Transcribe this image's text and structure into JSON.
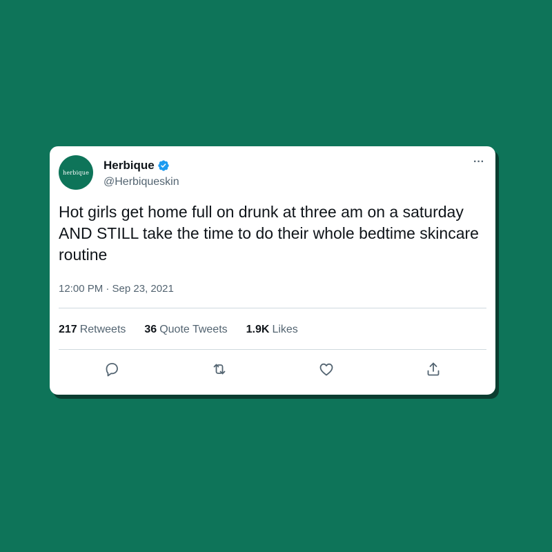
{
  "tweet": {
    "avatar_text": "herbique",
    "display_name": "Herbique",
    "handle": "@Herbiqueskin",
    "more_label": "···",
    "text": "Hot girls get home full on drunk at three am on a saturday AND STILL take the time to do their whole bedtime skincare routine",
    "timestamp": "12:00 PM · Sep 23, 2021",
    "stats": [
      {
        "value": "217",
        "label": "Retweets"
      },
      {
        "value": "36",
        "label": "Quote Tweets"
      },
      {
        "value": "1.9K",
        "label": "Likes"
      }
    ],
    "actions": [
      "reply-icon",
      "retweet-icon",
      "like-icon",
      "share-icon"
    ]
  },
  "colors": {
    "background": "#0e7459",
    "verified": "#1d9bf0",
    "text_primary": "#0f1419",
    "text_secondary": "#536471"
  }
}
